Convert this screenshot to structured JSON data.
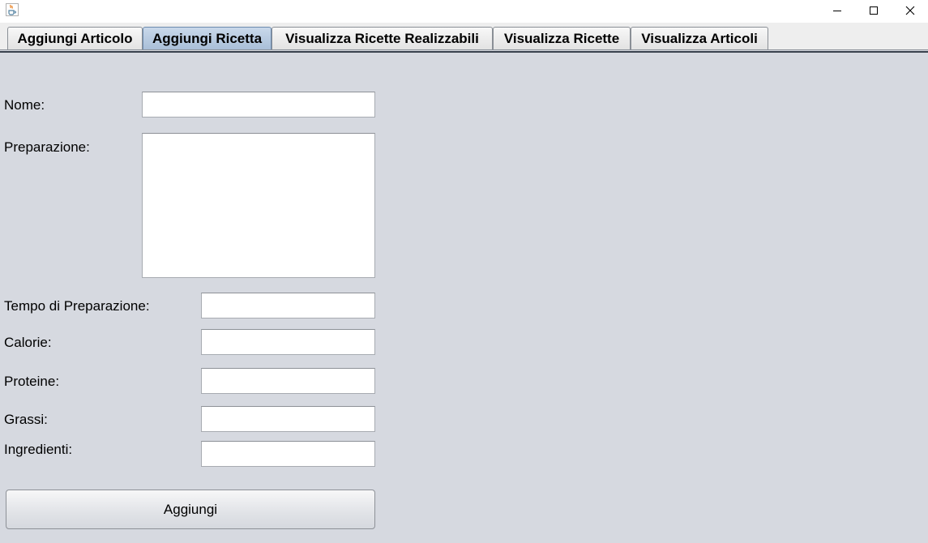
{
  "window": {
    "icon": "java-cup-icon",
    "controls": [
      "minimize-icon",
      "maximize-icon",
      "close-icon"
    ]
  },
  "tabs": [
    {
      "label": "Aggiungi Articolo",
      "selected": false
    },
    {
      "label": "Aggiungi Ricetta",
      "selected": true
    },
    {
      "label": "Visualizza Ricette Realizzabili",
      "selected": false
    },
    {
      "label": "Visualizza Ricette",
      "selected": false
    },
    {
      "label": "Visualizza Articoli",
      "selected": false
    }
  ],
  "form": {
    "nome": {
      "label": "Nome:",
      "value": ""
    },
    "preparazione": {
      "label": "Preparazione:",
      "value": ""
    },
    "tempo": {
      "label": "Tempo di Preparazione:",
      "value": ""
    },
    "calorie": {
      "label": "Calorie:",
      "value": ""
    },
    "proteine": {
      "label": "Proteine:",
      "value": ""
    },
    "grassi": {
      "label": "Grassi:",
      "value": ""
    },
    "ingredienti": {
      "label": "Ingredienti:",
      "value": ""
    },
    "submit_label": "Aggiungi"
  },
  "colors": {
    "background": "#d6d9e0",
    "selected_tab": "#b4c8e0",
    "tab": "#eeeeee"
  }
}
